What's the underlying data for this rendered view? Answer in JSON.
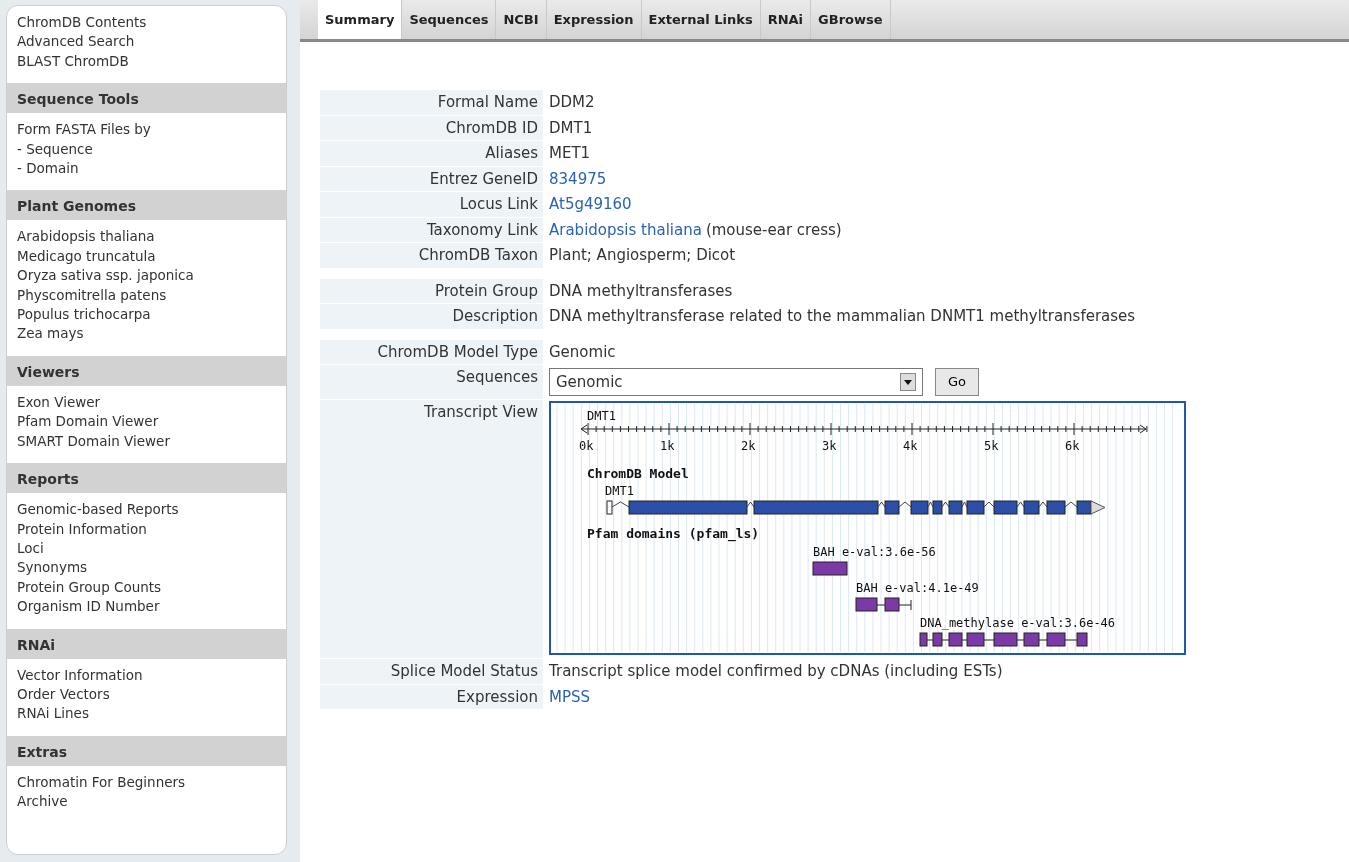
{
  "sidebar": {
    "sections": [
      {
        "items": [
          "ChromDB Contents",
          "Advanced Search",
          "BLAST ChromDB"
        ]
      },
      {
        "title": "Sequence Tools",
        "items": [
          "Form FASTA Files by",
          "- Sequence",
          "- Domain"
        ]
      },
      {
        "title": "Plant Genomes",
        "items": [
          "Arabidopsis thaliana",
          "Medicago truncatula",
          "Oryza sativa ssp. japonica",
          "Physcomitrella patens",
          "Populus trichocarpa",
          "Zea mays"
        ]
      },
      {
        "title": "Viewers",
        "items": [
          "Exon Viewer",
          "Pfam Domain Viewer",
          "SMART Domain Viewer"
        ]
      },
      {
        "title": "Reports",
        "items": [
          "Genomic-based Reports",
          "Protein Information",
          "Loci",
          "Synonyms",
          "Protein Group Counts",
          "Organism ID Number"
        ]
      },
      {
        "title": "RNAi",
        "items": [
          "Vector Information",
          "Order Vectors",
          "RNAi Lines"
        ]
      },
      {
        "title": "Extras",
        "items": [
          "Chromatin For Beginners",
          "Archive"
        ]
      }
    ]
  },
  "tabs": [
    {
      "label": "Summary",
      "selected": true
    },
    {
      "label": "Sequences",
      "selected": false
    },
    {
      "label": "NCBI",
      "selected": false
    },
    {
      "label": "Expression",
      "selected": false
    },
    {
      "label": "External Links",
      "selected": false
    },
    {
      "label": "RNAi",
      "selected": false
    },
    {
      "label": "GBrowse",
      "selected": false
    }
  ],
  "groups": [
    [
      {
        "label": "Formal Name",
        "kind": "text",
        "value": "DDM2"
      },
      {
        "label": "ChromDB ID",
        "kind": "text",
        "value": "DMT1"
      },
      {
        "label": "Aliases",
        "kind": "text",
        "value": "MET1"
      },
      {
        "label": "Entrez GeneID",
        "kind": "link",
        "value": "834975"
      },
      {
        "label": "Locus Link",
        "kind": "link",
        "value": "At5g49160"
      },
      {
        "label": "Taxonomy Link",
        "kind": "link",
        "value": "Arabidopsis thaliana",
        "suffix": "(mouse-ear cress)"
      },
      {
        "label": "ChromDB Taxon",
        "kind": "text",
        "value": "Plant; Angiosperm; Dicot"
      }
    ],
    [
      {
        "label": "Protein Group",
        "kind": "text",
        "value": "DNA methyltransferases"
      },
      {
        "label": "Description",
        "kind": "text",
        "value": "DNA methyltransferase related to the mammalian DNMT1 methyltransferases"
      }
    ],
    [
      {
        "label": "ChromDB Model Type",
        "kind": "text",
        "value": "Genomic"
      },
      {
        "label": "Sequences",
        "kind": "select",
        "value": "Genomic",
        "button": "Go"
      },
      {
        "label": "Transcript View",
        "kind": "transcript",
        "track_label": "DMT1",
        "ticks": [
          "0k",
          "1k",
          "2k",
          "3k",
          "4k",
          "5k",
          "6k"
        ],
        "model_title": "ChromDB Model",
        "model_label": "DMT1",
        "domains_title": "Pfam domains (pfam_ls)",
        "domains": [
          {
            "label": "BAH e-val:3.6e-56"
          },
          {
            "label": "BAH e-val:4.1e-49"
          },
          {
            "label": "DNA_methylase e-val:3.6e-46"
          }
        ]
      },
      {
        "label": "Splice Model Status",
        "kind": "text",
        "value": "Transcript splice model confirmed by cDNAs (including ESTs)"
      },
      {
        "label": "Expression",
        "kind": "link",
        "value": "MPSS"
      }
    ]
  ]
}
